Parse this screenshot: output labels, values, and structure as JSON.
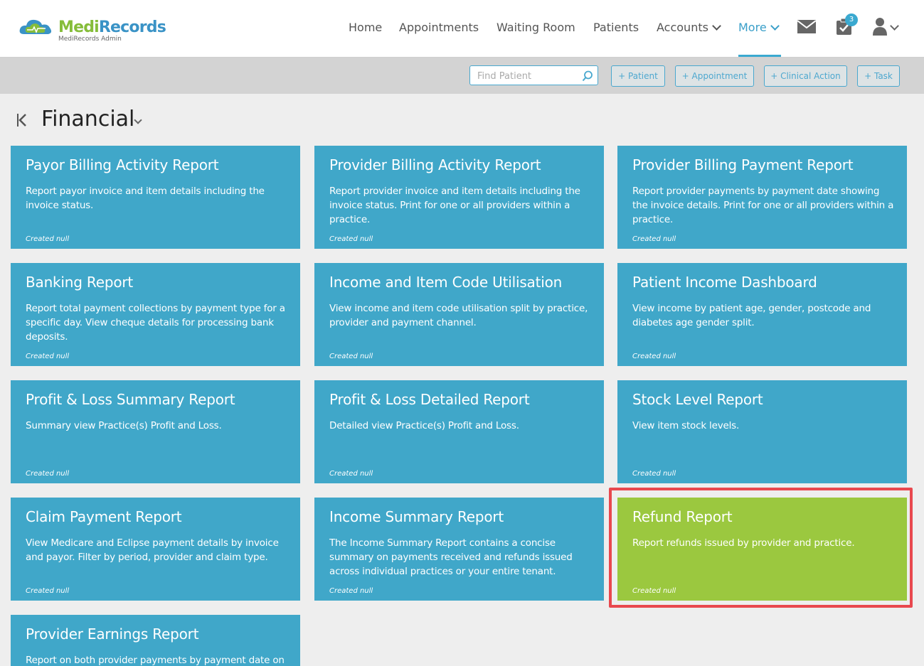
{
  "app": {
    "logo_name": "MediRecords",
    "logo_part1": "Medi",
    "logo_part2": "Records",
    "logo_subtitle": "MediRecords Admin"
  },
  "nav": {
    "items": [
      {
        "label": "Home"
      },
      {
        "label": "Appointments"
      },
      {
        "label": "Waiting Room"
      },
      {
        "label": "Patients"
      },
      {
        "label": "Accounts"
      },
      {
        "label": "More"
      }
    ],
    "active": "More",
    "tasks_badge": "3"
  },
  "toolbar": {
    "search_placeholder": "Find Patient",
    "buttons": [
      {
        "label": "+ Patient"
      },
      {
        "label": "+ Appointment"
      },
      {
        "label": "+ Clinical Action"
      },
      {
        "label": "+ Task"
      }
    ]
  },
  "page": {
    "title": "Financial"
  },
  "cards": [
    {
      "title": "Payor Billing Activity Report",
      "description": "Report payor invoice and item details including the invoice status.",
      "meta": "Created null"
    },
    {
      "title": "Provider Billing Activity Report",
      "description": "Report provider invoice and item details including the invoice status. Print for one or all providers within a practice.",
      "meta": "Created null"
    },
    {
      "title": "Provider Billing Payment Report",
      "description": "Report provider payments by payment date showing the invoice details. Print for one or all providers within a practice.",
      "meta": "Created null"
    },
    {
      "title": "Banking Report",
      "description": "Report total payment collections by payment type for a specific day. View cheque details for processing bank deposits.",
      "meta": "Created null"
    },
    {
      "title": "Income and Item Code Utilisation",
      "description": "View income and item code utilisation split by practice, provider and payment channel.",
      "meta": "Created null"
    },
    {
      "title": "Patient Income Dashboard",
      "description": "View income by patient age, gender, postcode and diabetes age gender split.",
      "meta": "Created null"
    },
    {
      "title": "Profit & Loss Summary Report",
      "description": "Summary view Practice(s) Profit and Loss.",
      "meta": "Created null"
    },
    {
      "title": "Profit & Loss Detailed Report",
      "description": "Detailed view Practice(s) Profit and Loss.",
      "meta": "Created null"
    },
    {
      "title": "Stock Level Report",
      "description": "View item stock levels.",
      "meta": "Created null"
    },
    {
      "title": "Claim Payment Report",
      "description": "View Medicare and Eclipse payment details by invoice and payor. Filter by period, provider and claim type.",
      "meta": "Created null"
    },
    {
      "title": "Income Summary Report",
      "description": "The Income Summary Report contains a concise summary on payments received and refunds issued across individual practices or your entire tenant.",
      "meta": "Created null"
    },
    {
      "title": "Refund Report",
      "description": "Report refunds issued by provider and practice.",
      "meta": "Created null"
    },
    {
      "title": "Provider Earnings Report",
      "description": "Report on both provider payments by payment date on",
      "meta": ""
    }
  ],
  "colors": {
    "card_blue": "#40a7c9",
    "card_green": "#9bc83f",
    "highlight": "#e8484e",
    "accent": "#3aa9d0"
  }
}
